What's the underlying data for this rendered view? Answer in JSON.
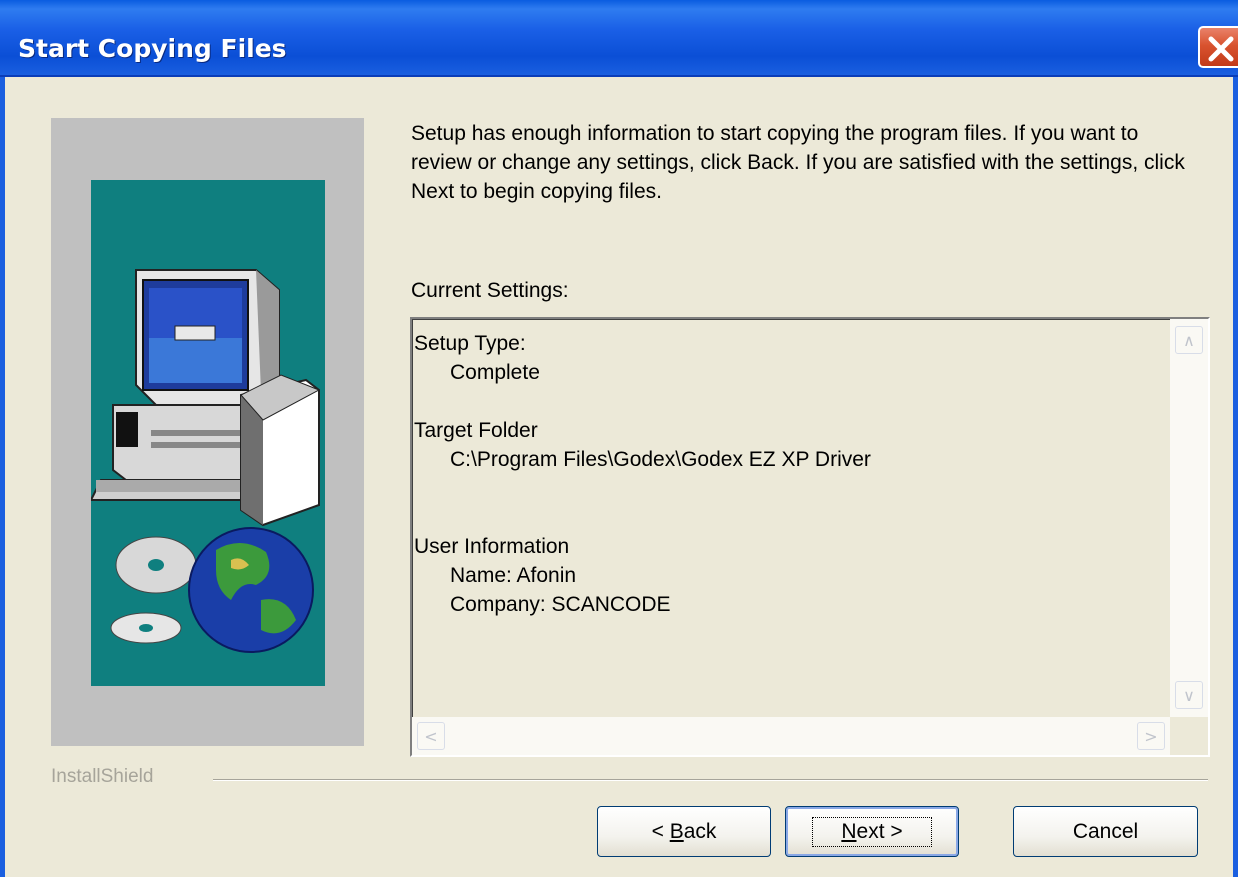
{
  "window": {
    "title": "Start Copying Files"
  },
  "intro_text": "Setup has enough information to start copying the program files.  If you want to review or change any settings, click Back.  If you are satisfied with the settings, click Next to begin copying files.",
  "current_settings": {
    "label": "Current Settings:",
    "setup_type_label": "Setup Type:",
    "setup_type_value": "Complete",
    "target_folder_label": "Target Folder",
    "target_folder_value": "C:\\Program Files\\Godex\\Godex EZ XP Driver",
    "user_info_label": "User Information",
    "user_name": "Name:  Afonin",
    "user_company": "Company:  SCANCODE"
  },
  "brand": "InstallShield",
  "buttons": {
    "back_mnemonic": "B",
    "back_rest": "ack",
    "back_prefix": "< ",
    "next_mnemonic": "N",
    "next_rest": "ext",
    "next_suffix": " >",
    "cancel": "Cancel"
  },
  "colors": {
    "titlebar": "#0b4fd6",
    "dialog_bg": "#ece9d8",
    "art_panel": "#c0c0c0",
    "art_teal": "#0f7f7f",
    "close_button": "#d9532f"
  },
  "icons": {
    "close": "close-x-icon",
    "computer": "computer-illustration",
    "globe": "globe-cd-illustration"
  }
}
